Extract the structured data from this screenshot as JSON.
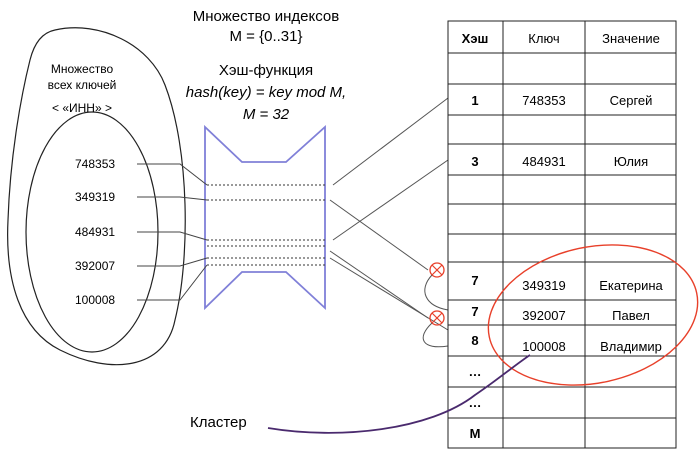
{
  "index_set": {
    "title": "Множество индексов",
    "formula": "M = {0..31}"
  },
  "hash_function": {
    "title": "Хэш-функция",
    "formula": "hash(key) = key mod M,",
    "param": "M = 32"
  },
  "key_set": {
    "title_line1": "Множество",
    "title_line2": "всех ключей",
    "subtitle": "< «ИНН» >",
    "keys": [
      "748353",
      "349319",
      "484931",
      "392007",
      "100008"
    ]
  },
  "table": {
    "headers": [
      "Хэш",
      "Ключ",
      "Значение"
    ],
    "rows": [
      {
        "hash": "",
        "key": "",
        "value": ""
      },
      {
        "hash": "1",
        "key": "748353",
        "value": "Сергей"
      },
      {
        "hash": "",
        "key": "",
        "value": ""
      },
      {
        "hash": "3",
        "key": "484931",
        "value": "Юлия"
      },
      {
        "hash": "",
        "key": "",
        "value": ""
      },
      {
        "hash": "",
        "key": "",
        "value": ""
      },
      {
        "hash": "7",
        "key": "349319",
        "value": "Екатерина"
      },
      {
        "hash": "7",
        "key": "392007",
        "value": "Павел"
      },
      {
        "hash": "8",
        "key": "100008",
        "value": "Владимир"
      },
      {
        "hash": "…",
        "key": "",
        "value": ""
      },
      {
        "hash": "…",
        "key": "",
        "value": ""
      },
      {
        "hash": "M",
        "key": "",
        "value": ""
      }
    ]
  },
  "cluster_label": "Кластер",
  "colors": {
    "funnel": "#8080d8",
    "cluster": "#e8402a",
    "cluster_pointer": "#4a2a6e",
    "collision": "#e8402a",
    "lines": "#555555"
  }
}
